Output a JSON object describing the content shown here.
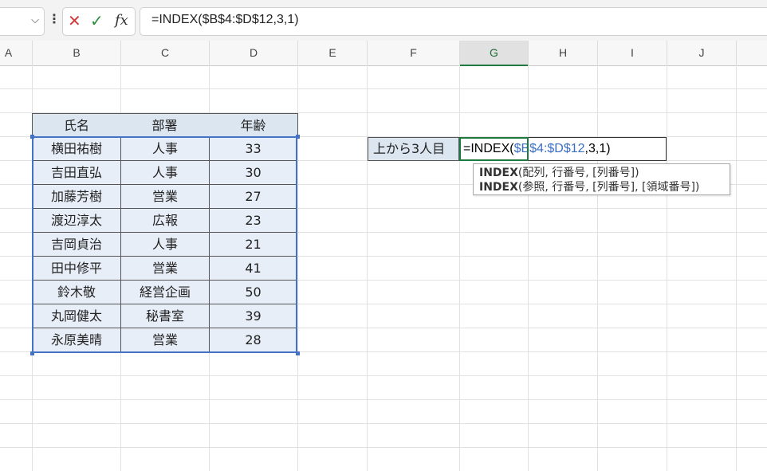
{
  "formula_bar": {
    "formula": "=INDEX($B$4:$D$12,3,1)",
    "fx_label": "fx"
  },
  "columns": [
    "A",
    "B",
    "C",
    "D",
    "E",
    "F",
    "G",
    "H",
    "I",
    "J"
  ],
  "selected_column": "G",
  "table": {
    "headers": [
      "氏名",
      "部署",
      "年齢"
    ],
    "rows": [
      [
        "横田祐樹",
        "人事",
        "33"
      ],
      [
        "吉田直弘",
        "人事",
        "30"
      ],
      [
        "加藤芳樹",
        "営業",
        "27"
      ],
      [
        "渡辺淳太",
        "広報",
        "23"
      ],
      [
        "吉岡貞治",
        "人事",
        "21"
      ],
      [
        "田中修平",
        "営業",
        "41"
      ],
      [
        "鈴木敬",
        "経営企画",
        "50"
      ],
      [
        "丸岡健太",
        "秘書室",
        "39"
      ],
      [
        "永原美晴",
        "営業",
        "28"
      ]
    ]
  },
  "label_cell": "上から3人目",
  "edit_cell": {
    "prefix": "=INDEX(",
    "ref": "$B$4:$D$12",
    "suffix": ",3,1)"
  },
  "tooltip": {
    "line1_fn": "INDEX",
    "line1_args": "(配列, 行番号, [列番号])",
    "line2_fn": "INDEX",
    "line2_args": "(参照, 行番号, [列番号], [領域番号])"
  },
  "colors": {
    "selection": "#4472c4",
    "active_cell": "#1e7a3e",
    "header_fill": "#dce6f1",
    "reference_text": "#3a6fc4"
  }
}
